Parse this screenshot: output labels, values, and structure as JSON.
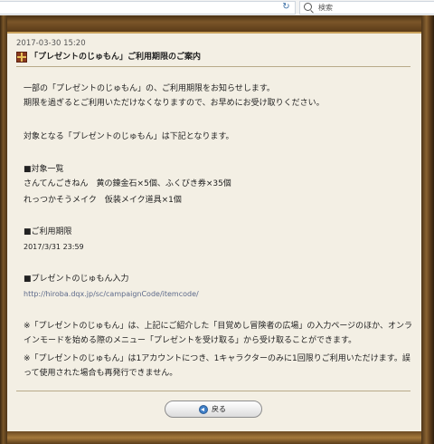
{
  "browser": {
    "search_placeholder": "検索"
  },
  "post": {
    "datetime": "2017-03-30 15:20",
    "title": "「プレゼントのじゅもん」ご利用期限のご案内",
    "intro_1": "一部の「プレゼントのじゅもん」の、ご利用期限をお知らせします。",
    "intro_2": "期限を過ぎるとご利用いただけなくなりますので、お早めにお受け取りください。",
    "target_text": "対象となる「プレゼントのじゅもん」は下記となります。",
    "list_heading": "■対象一覧",
    "items": [
      "さんてんごきねん　黄の錬金石×5個、ふくびき券×35個",
      "れっつかそうメイク　仮装メイク道具×1個"
    ],
    "deadline_heading": "■ご利用期限",
    "deadline_value": "2017/3/31 23:59",
    "entry_heading": "■プレゼントのじゅもん入力",
    "entry_url": "http://hiroba.dqx.jp/sc/campaignCode/itemcode/",
    "note_1": "※「プレゼントのじゅもん」は、上記にご紹介した「目覚めし冒険者の広場」の入力ページのほか、オンラインモードを始める際のメニュー「プレゼントを受け取る」から受け取ることができます。",
    "note_2": "※「プレゼントのじゅもん」は1アカウントにつき、1キャラクターのみに1回限りご利用いただけます。誤って使用された場合も再発行できません。",
    "back_label": "戻る"
  }
}
